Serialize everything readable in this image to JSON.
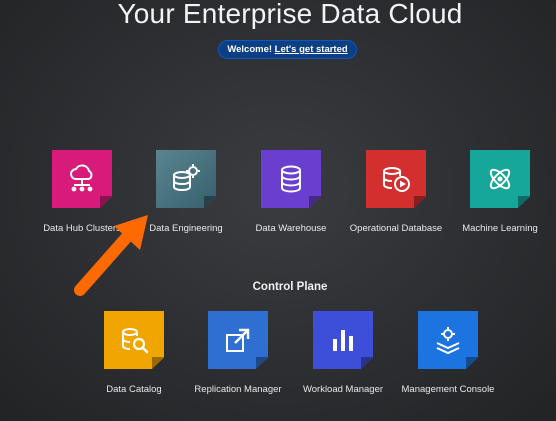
{
  "page": {
    "title": "Your Enterprise Data Cloud",
    "welcome_text": "Welcome!",
    "welcome_link": "Let's get started"
  },
  "services": [
    {
      "label": "Data Hub Clusters",
      "icon": "cloud-network-icon",
      "color": "#d81b7a"
    },
    {
      "label": "Data Engineering",
      "icon": "database-gear-icon",
      "color": "#4a7480"
    },
    {
      "label": "Data Warehouse",
      "icon": "database-stack-icon",
      "color": "#6a3fd0"
    },
    {
      "label": "Operational Database",
      "icon": "database-play-icon",
      "color": "#d32f2f"
    },
    {
      "label": "Machine Learning",
      "icon": "atom-icon",
      "color": "#17a79a"
    }
  ],
  "control_plane": {
    "heading": "Control Plane",
    "items": [
      {
        "label": "Data Catalog",
        "icon": "catalog-search-icon",
        "color": "#f0a500"
      },
      {
        "label": "Replication Manager",
        "icon": "replicate-arrows-icon",
        "color": "#2f6fd1"
      },
      {
        "label": "Workload Manager",
        "icon": "bar-chart-icon",
        "color": "#3d4fd8"
      },
      {
        "label": "Management Console",
        "icon": "gear-layers-icon",
        "color": "#1c74e0"
      }
    ]
  },
  "annotation": {
    "arrow_color": "#ff6a00",
    "icon": "pointer-arrow-icon"
  }
}
